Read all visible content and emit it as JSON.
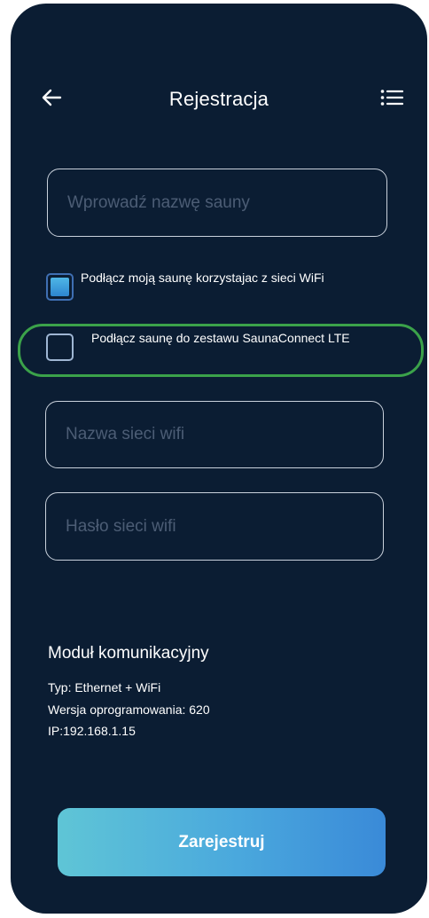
{
  "header": {
    "title": "Rejestracja",
    "back_icon": "arrow-left-icon",
    "menu_icon": "list-menu-icon"
  },
  "form": {
    "sauna_name": {
      "value": "",
      "placeholder": "Wprowadź nazwę sauny"
    },
    "options": [
      {
        "label": "Podłącz moją saunę korzystajac z sieci WiFi",
        "checked": true
      },
      {
        "label": "Podłącz saunę do zestawu SaunaConnect LTE",
        "checked": false
      }
    ],
    "wifi_name": {
      "value": "",
      "placeholder": "Nazwa sieci wifi"
    },
    "wifi_password": {
      "value": "",
      "placeholder": "Hasło sieci wifi"
    }
  },
  "module": {
    "title": "Moduł komunikacyjny",
    "type": "Typ: Ethernet + WiFi",
    "firmware": "Wersja oprogramowania: 620",
    "ip": "IP:192.168.1.15"
  },
  "actions": {
    "register_label": "Zarejestruj"
  },
  "colors": {
    "background": "#0b1d33",
    "accent_start": "#5fc5d6",
    "accent_end": "#3a8ad8",
    "highlight": "#3ba24a"
  }
}
